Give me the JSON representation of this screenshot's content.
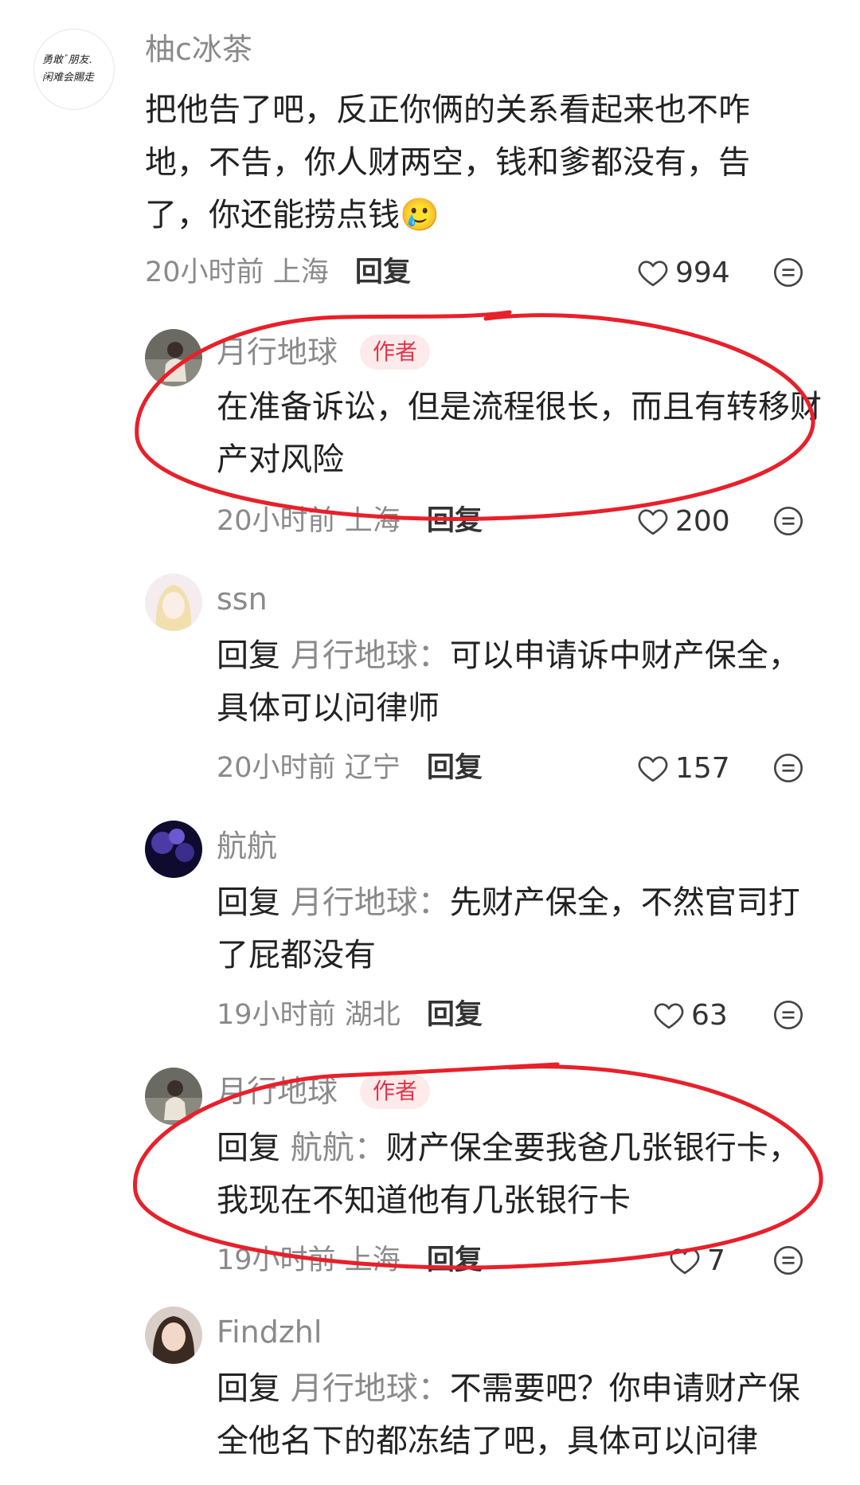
{
  "comments": [
    {
      "username": "柚c冰茶",
      "avatar_text_line1": "勇敢ﾞ朋友.",
      "avatar_text_line2": "闲难会賜走",
      "text": "把他告了吧，反正你俩的关系看起来也不咋地，不告，你人财两空，钱和爹都没有，告了，你还能捞点钱🥲",
      "time": "20小时前",
      "location": "上海",
      "reply_label": "回复",
      "likes": "994"
    },
    {
      "username": "月行地球",
      "author_tag": "作者",
      "text": "在准备诉讼，但是流程很长，而且有转移财产对风险",
      "time": "20小时前",
      "location": "上海",
      "reply_label": "回复",
      "likes": "200"
    },
    {
      "username": "ssn",
      "reply_prefix": "回复",
      "reply_target": "月行地球",
      "text": "可以申请诉中财产保全，具体可以问律师",
      "time": "20小时前",
      "location": "辽宁",
      "reply_label": "回复",
      "likes": "157"
    },
    {
      "username": "航航",
      "reply_prefix": "回复",
      "reply_target": "月行地球",
      "text": "先财产保全，不然官司打了屁都没有",
      "time": "19小时前",
      "location": "湖北",
      "reply_label": "回复",
      "likes": "63"
    },
    {
      "username": "月行地球",
      "author_tag": "作者",
      "reply_prefix": "回复",
      "reply_target": "航航",
      "text": "财产保全要我爸几张银行卡，我现在不知道他有几张银行卡",
      "time": "19小时前",
      "location": "上海",
      "reply_label": "回复",
      "likes": "7"
    },
    {
      "username": "Findzhl",
      "reply_prefix": "回复",
      "reply_target": "月行地球",
      "text": "不需要吧？你申请财产保全他名下的都冻结了吧，具体可以问律"
    }
  ],
  "colors": {
    "annotation_red": "#e8202a",
    "author_tag_bg": "#fdeaea",
    "author_tag_text": "#e0354b"
  },
  "icons": [
    "heart-icon",
    "more-dots-icon"
  ]
}
